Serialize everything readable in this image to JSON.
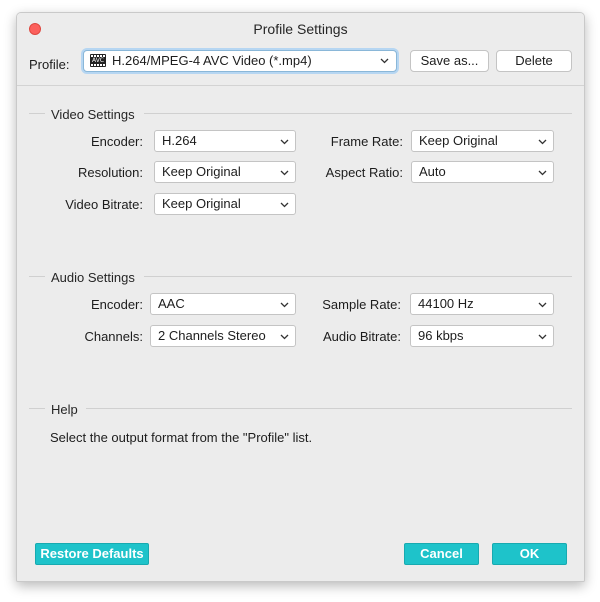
{
  "window": {
    "title": "Profile Settings"
  },
  "profile": {
    "label": "Profile:",
    "icon_text": "AVC",
    "selected": "H.264/MPEG-4 AVC Video (*.mp4)",
    "save_as_label": "Save as...",
    "delete_label": "Delete"
  },
  "video": {
    "heading": "Video Settings",
    "encoder_label": "Encoder:",
    "encoder_value": "H.264",
    "resolution_label": "Resolution:",
    "resolution_value": "Keep Original",
    "bitrate_label": "Video Bitrate:",
    "bitrate_value": "Keep Original",
    "framerate_label": "Frame Rate:",
    "framerate_value": "Keep Original",
    "aspect_label": "Aspect Ratio:",
    "aspect_value": "Auto"
  },
  "audio": {
    "heading": "Audio Settings",
    "encoder_label": "Encoder:",
    "encoder_value": "AAC",
    "channels_label": "Channels:",
    "channels_value": "2 Channels Stereo",
    "samplerate_label": "Sample Rate:",
    "samplerate_value": "44100 Hz",
    "bitrate_label": "Audio Bitrate:",
    "bitrate_value": "96 kbps"
  },
  "help": {
    "heading": "Help",
    "text": "Select the output format from the \"Profile\" list."
  },
  "footer": {
    "restore_label": "Restore Defaults",
    "cancel_label": "Cancel",
    "ok_label": "OK"
  },
  "colors": {
    "accent": "#1ec3ca",
    "close": "#fc605c",
    "focus_ring": "#b6d6f2"
  },
  "icons": [
    "close-icon",
    "avc-file-icon",
    "chevron-down-icon"
  ]
}
